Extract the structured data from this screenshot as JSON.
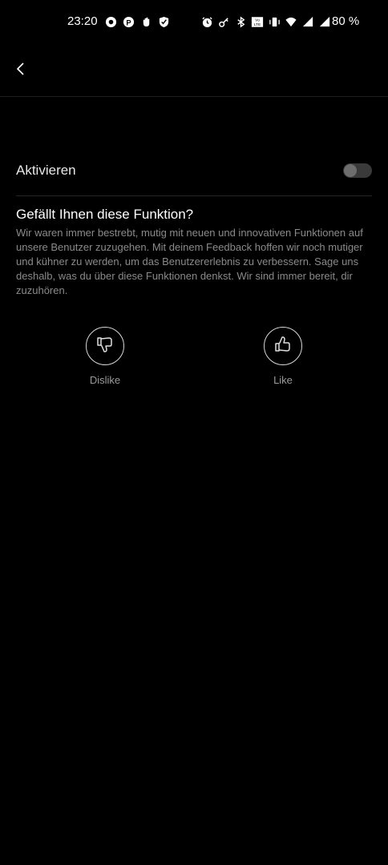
{
  "status_bar": {
    "time": "23:20",
    "battery": "80 %",
    "icons_left": [
      "chat-icon",
      "parking-icon",
      "hand-icon",
      "shield-icon"
    ],
    "icons_right": [
      "alarm-icon",
      "key-icon",
      "bluetooth-icon",
      "volte-icon",
      "vibrate-icon",
      "wifi-icon",
      "signal-icon",
      "signal-icon"
    ]
  },
  "app_bar": {
    "back_icon": "chevron-left-icon"
  },
  "settings": {
    "activate_label": "Aktivieren",
    "activate_enabled": false
  },
  "feedback": {
    "title": "Gefällt Ihnen diese Funktion?",
    "body": "Wir waren immer bestrebt, mutig mit neuen und innovativen Funktionen auf unsere Benutzer zuzugehen. Mit deinem Feedback hoffen wir noch mutiger und kühner zu werden, um das Benutzererlebnis zu verbessern. Sage uns deshalb, was du über diese Funktionen denkst. Wir sind immer bereit, dir zuzuhören.",
    "dislike_label": "Dislike",
    "like_label": "Like"
  },
  "colors": {
    "background": "#000000",
    "text_primary": "#ffffff",
    "text_secondary": "#8a8a8a"
  }
}
